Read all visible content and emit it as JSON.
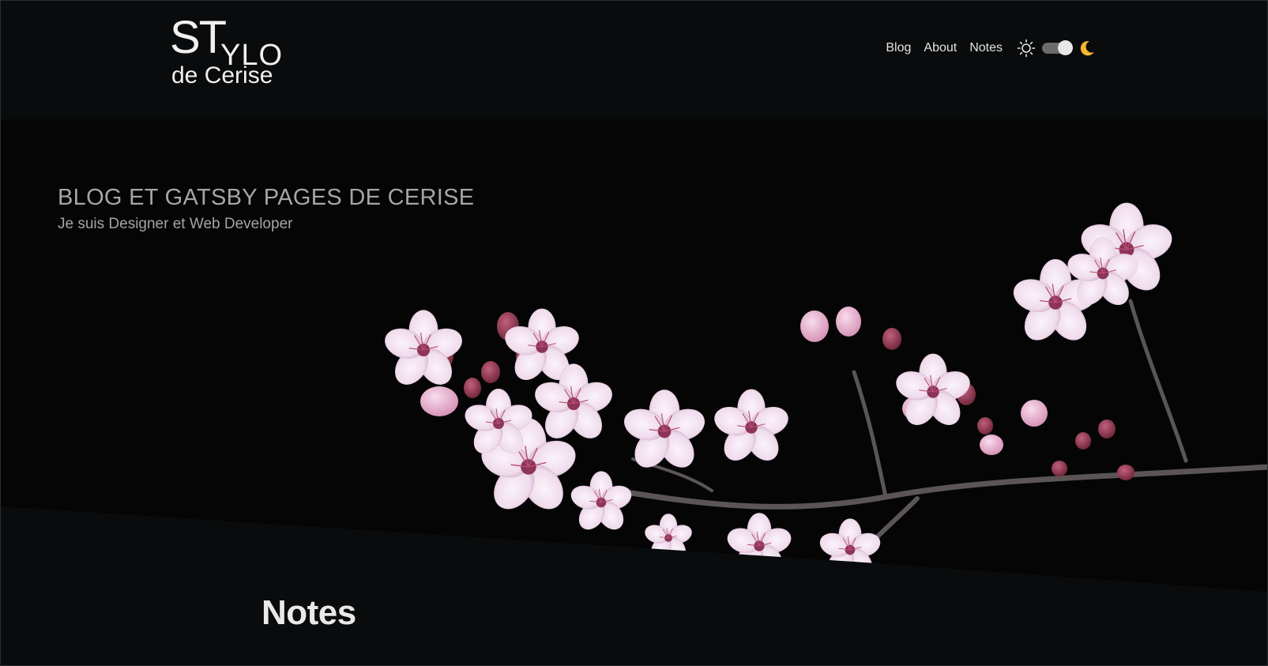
{
  "logo": {
    "big": "ST",
    "thin": "YLO",
    "sub": "de Cerise"
  },
  "nav": {
    "items": [
      "Blog",
      "About",
      "Notes"
    ],
    "theme_toggle": {
      "light_icon": "sun-icon",
      "dark_icon": "moon-icon",
      "state": "dark"
    }
  },
  "hero": {
    "title": "BLOG ET GATSBY PAGES DE CERISE",
    "subtitle": "Je suis Designer et Web Developer",
    "image": "cherry-blossom-branch"
  },
  "section": {
    "title": "Notes"
  },
  "colors": {
    "background": "#090b0c",
    "accent_moon": "#f3b62e",
    "blossom": "#f1dfee"
  }
}
